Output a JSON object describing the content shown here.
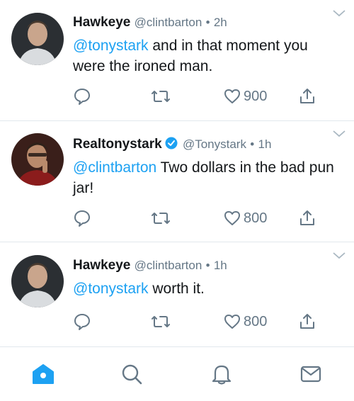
{
  "tweets": [
    {
      "name": "Hawkeye",
      "verified": false,
      "handle": "@clintbarton",
      "dot": "•",
      "time": "2h",
      "mention": "@tonystark",
      "text": " and in that moment you were the ironed man.",
      "likes": "900"
    },
    {
      "name": "Realtonystark",
      "verified": true,
      "handle": "@Tonystark",
      "dot": "•",
      "time": "1h",
      "mention": "@clintbarton",
      "text": " Two dollars in the bad pun jar!",
      "likes": "800"
    },
    {
      "name": "Hawkeye",
      "verified": false,
      "handle": "@clintbarton",
      "dot": "•",
      "time": "1h",
      "mention": "@tonystark",
      "text": " worth it.",
      "likes": "800"
    }
  ],
  "tabs": [
    "home-icon",
    "search-icon",
    "notifications-icon",
    "messages-icon"
  ],
  "colors": {
    "accent": "#1da1f2",
    "muted": "#657786",
    "divider": "#e1e8ed"
  }
}
